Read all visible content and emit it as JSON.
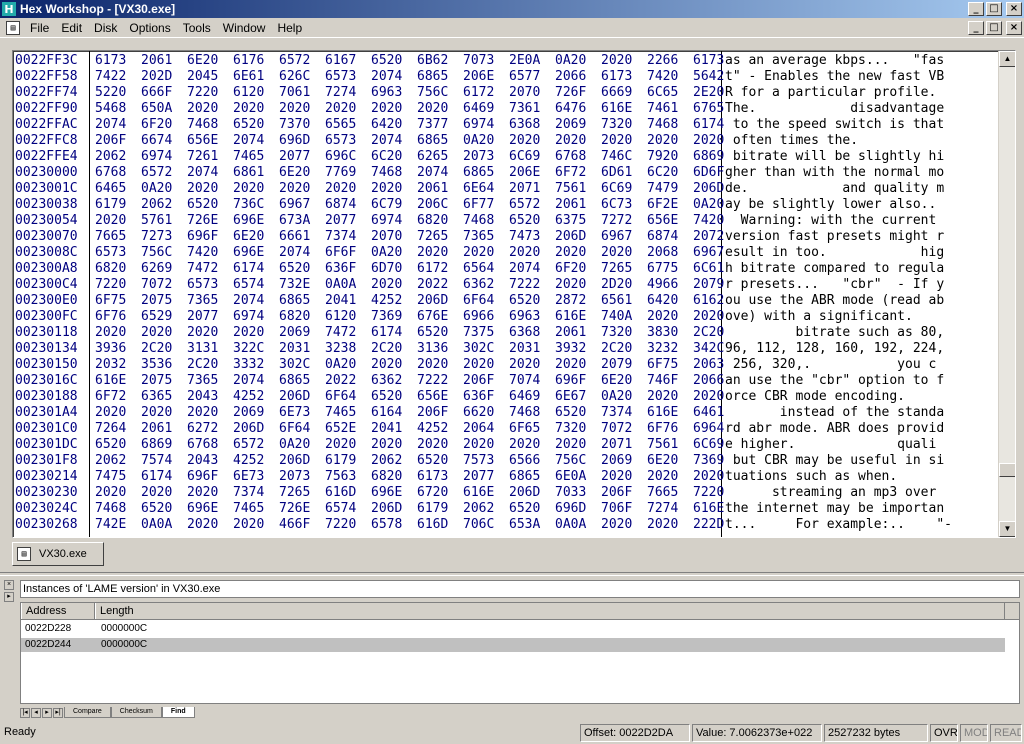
{
  "window": {
    "title": "Hex Workshop - [VX30.exe]",
    "app_glyph": "H"
  },
  "menu": [
    "File",
    "Edit",
    "Disk",
    "Options",
    "Tools",
    "Window",
    "Help"
  ],
  "window_buttons": {
    "minimize": "_",
    "maximize": "□",
    "close": "×"
  },
  "hex_rows": [
    {
      "addr": "0022FF3C",
      "hex": [
        "6173",
        "2061",
        "6E20",
        "6176",
        "6572",
        "6167",
        "6520",
        "6B62",
        "7073",
        "2E0A",
        "0A20",
        "2020",
        "2266",
        "6173"
      ],
      "ascii": "as an average kbps...   \"fas"
    },
    {
      "addr": "0022FF58",
      "hex": [
        "7422",
        "202D",
        "2045",
        "6E61",
        "626C",
        "6573",
        "2074",
        "6865",
        "206E",
        "6577",
        "2066",
        "6173",
        "7420",
        "5642"
      ],
      "ascii": "t\" - Enables the new fast VB"
    },
    {
      "addr": "0022FF74",
      "hex": [
        "5220",
        "666F",
        "7220",
        "6120",
        "7061",
        "7274",
        "6963",
        "756C",
        "6172",
        "2070",
        "726F",
        "6669",
        "6C65",
        "2E20"
      ],
      "ascii": "R for a particular profile. "
    },
    {
      "addr": "0022FF90",
      "hex": [
        "5468",
        "650A",
        "2020",
        "2020",
        "2020",
        "2020",
        "2020",
        "2020",
        "6469",
        "7361",
        "6476",
        "616E",
        "7461",
        "6765"
      ],
      "ascii": "The.            disadvantage"
    },
    {
      "addr": "0022FFAC",
      "hex": [
        "2074",
        "6F20",
        "7468",
        "6520",
        "7370",
        "6565",
        "6420",
        "7377",
        "6974",
        "6368",
        "2069",
        "7320",
        "7468",
        "6174"
      ],
      "ascii": " to the speed switch is that"
    },
    {
      "addr": "0022FFC8",
      "hex": [
        "206F",
        "6674",
        "656E",
        "2074",
        "696D",
        "6573",
        "2074",
        "6865",
        "0A20",
        "2020",
        "2020",
        "2020",
        "2020",
        "2020"
      ],
      "ascii": " often times the.           "
    },
    {
      "addr": "0022FFE4",
      "hex": [
        "2062",
        "6974",
        "7261",
        "7465",
        "2077",
        "696C",
        "6C20",
        "6265",
        "2073",
        "6C69",
        "6768",
        "746C",
        "7920",
        "6869"
      ],
      "ascii": " bitrate will be slightly hi"
    },
    {
      "addr": "00230000",
      "hex": [
        "6768",
        "6572",
        "2074",
        "6861",
        "6E20",
        "7769",
        "7468",
        "2074",
        "6865",
        "206E",
        "6F72",
        "6D61",
        "6C20",
        "6D6F"
      ],
      "ascii": "gher than with the normal mo"
    },
    {
      "addr": "0023001C",
      "hex": [
        "6465",
        "0A20",
        "2020",
        "2020",
        "2020",
        "2020",
        "2020",
        "2061",
        "6E64",
        "2071",
        "7561",
        "6C69",
        "7479",
        "206D"
      ],
      "ascii": "de.            and quality m"
    },
    {
      "addr": "00230038",
      "hex": [
        "6179",
        "2062",
        "6520",
        "736C",
        "6967",
        "6874",
        "6C79",
        "206C",
        "6F77",
        "6572",
        "2061",
        "6C73",
        "6F2E",
        "0A20"
      ],
      "ascii": "ay be slightly lower also.. "
    },
    {
      "addr": "00230054",
      "hex": [
        "2020",
        "5761",
        "726E",
        "696E",
        "673A",
        "2077",
        "6974",
        "6820",
        "7468",
        "6520",
        "6375",
        "7272",
        "656E",
        "7420"
      ],
      "ascii": "  Warning: with the current "
    },
    {
      "addr": "00230070",
      "hex": [
        "7665",
        "7273",
        "696F",
        "6E20",
        "6661",
        "7374",
        "2070",
        "7265",
        "7365",
        "7473",
        "206D",
        "6967",
        "6874",
        "2072"
      ],
      "ascii": "version fast presets might r"
    },
    {
      "addr": "0023008C",
      "hex": [
        "6573",
        "756C",
        "7420",
        "696E",
        "2074",
        "6F6F",
        "0A20",
        "2020",
        "2020",
        "2020",
        "2020",
        "2020",
        "2068",
        "6967"
      ],
      "ascii": "esult in too.            hig"
    },
    {
      "addr": "002300A8",
      "hex": [
        "6820",
        "6269",
        "7472",
        "6174",
        "6520",
        "636F",
        "6D70",
        "6172",
        "6564",
        "2074",
        "6F20",
        "7265",
        "6775",
        "6C61"
      ],
      "ascii": "h bitrate compared to regula"
    },
    {
      "addr": "002300C4",
      "hex": [
        "7220",
        "7072",
        "6573",
        "6574",
        "732E",
        "0A0A",
        "2020",
        "2022",
        "6362",
        "7222",
        "2020",
        "2D20",
        "4966",
        "2079"
      ],
      "ascii": "r presets...   \"cbr\"  - If y"
    },
    {
      "addr": "002300E0",
      "hex": [
        "6F75",
        "2075",
        "7365",
        "2074",
        "6865",
        "2041",
        "4252",
        "206D",
        "6F64",
        "6520",
        "2872",
        "6561",
        "6420",
        "6162"
      ],
      "ascii": "ou use the ABR mode (read ab"
    },
    {
      "addr": "002300FC",
      "hex": [
        "6F76",
        "6529",
        "2077",
        "6974",
        "6820",
        "6120",
        "7369",
        "676E",
        "6966",
        "6963",
        "616E",
        "740A",
        "2020",
        "2020"
      ],
      "ascii": "ove) with a significant.    "
    },
    {
      "addr": "00230118",
      "hex": [
        "2020",
        "2020",
        "2020",
        "2020",
        "2069",
        "7472",
        "6174",
        "6520",
        "7375",
        "6368",
        "2061",
        "7320",
        "3830",
        "2C20"
      ],
      "ascii": "         bitrate such as 80, "
    },
    {
      "addr": "00230134",
      "hex": [
        "3936",
        "2C20",
        "3131",
        "322C",
        "2031",
        "3238",
        "2C20",
        "3136",
        "302C",
        "2031",
        "3932",
        "2C20",
        "3232",
        "342C"
      ],
      "ascii": "96, 112, 128, 160, 192, 224,"
    },
    {
      "addr": "00230150",
      "hex": [
        "2032",
        "3536",
        "2C20",
        "3332",
        "302C",
        "0A20",
        "2020",
        "2020",
        "2020",
        "2020",
        "2020",
        "2079",
        "6F75",
        "2063"
      ],
      "ascii": " 256, 320,.           you c"
    },
    {
      "addr": "0023016C",
      "hex": [
        "616E",
        "2075",
        "7365",
        "2074",
        "6865",
        "2022",
        "6362",
        "7222",
        "206F",
        "7074",
        "696F",
        "6E20",
        "746F",
        "2066"
      ],
      "ascii": "an use the \"cbr\" option to f"
    },
    {
      "addr": "00230188",
      "hex": [
        "6F72",
        "6365",
        "2043",
        "4252",
        "206D",
        "6F64",
        "6520",
        "656E",
        "636F",
        "6469",
        "6E67",
        "0A20",
        "2020",
        "2020"
      ],
      "ascii": "orce CBR mode encoding.     "
    },
    {
      "addr": "002301A4",
      "hex": [
        "2020",
        "2020",
        "2020",
        "2069",
        "6E73",
        "7465",
        "6164",
        "206F",
        "6620",
        "7468",
        "6520",
        "7374",
        "616E",
        "6461"
      ],
      "ascii": "       instead of the standa"
    },
    {
      "addr": "002301C0",
      "hex": [
        "7264",
        "2061",
        "6272",
        "206D",
        "6F64",
        "652E",
        "2041",
        "4252",
        "2064",
        "6F65",
        "7320",
        "7072",
        "6F76",
        "6964"
      ],
      "ascii": "rd abr mode. ABR does provid"
    },
    {
      "addr": "002301DC",
      "hex": [
        "6520",
        "6869",
        "6768",
        "6572",
        "0A20",
        "2020",
        "2020",
        "2020",
        "2020",
        "2020",
        "2020",
        "2071",
        "7561",
        "6C69"
      ],
      "ascii": "e higher.             quali"
    },
    {
      "addr": "002301F8",
      "hex": [
        "2062",
        "7574",
        "2043",
        "4252",
        "206D",
        "6179",
        "2062",
        "6520",
        "7573",
        "6566",
        "756C",
        "2069",
        "6E20",
        "7369"
      ],
      "ascii": " but CBR may be useful in si"
    },
    {
      "addr": "00230214",
      "hex": [
        "7475",
        "6174",
        "696F",
        "6E73",
        "2073",
        "7563",
        "6820",
        "6173",
        "2077",
        "6865",
        "6E0A",
        "2020",
        "2020",
        "2020"
      ],
      "ascii": "tuations such as when.      "
    },
    {
      "addr": "00230230",
      "hex": [
        "2020",
        "2020",
        "2020",
        "7374",
        "7265",
        "616D",
        "696E",
        "6720",
        "616E",
        "206D",
        "7033",
        "206F",
        "7665",
        "7220"
      ],
      "ascii": "      streaming an mp3 over "
    },
    {
      "addr": "0023024C",
      "hex": [
        "7468",
        "6520",
        "696E",
        "7465",
        "726E",
        "6574",
        "206D",
        "6179",
        "2062",
        "6520",
        "696D",
        "706F",
        "7274",
        "616E"
      ],
      "ascii": "the internet may be importan"
    },
    {
      "addr": "00230268",
      "hex": [
        "742E",
        "0A0A",
        "2020",
        "2020",
        "466F",
        "7220",
        "6578",
        "616D",
        "706C",
        "653A",
        "0A0A",
        "2020",
        "2020",
        "222D"
      ],
      "ascii": "t...     For example:..    \"-"
    }
  ],
  "file_tab": {
    "label": "VX30.exe"
  },
  "results": {
    "caption": "Instances of 'LAME version' in VX30.exe",
    "columns": [
      "Address",
      "Length"
    ],
    "rows": [
      {
        "address": "0022D228",
        "length": "0000000C"
      },
      {
        "address": "0022D244",
        "length": "0000000C"
      }
    ],
    "tabs": [
      "Compare",
      "Checksum",
      "Find"
    ]
  },
  "status": {
    "ready": "Ready",
    "offset": "Offset: 0022D2DA",
    "value": "Value: 7.0062373e+022",
    "size": "2527232 bytes",
    "ovr": "OVR",
    "mod": "MOD",
    "read": "READ"
  }
}
